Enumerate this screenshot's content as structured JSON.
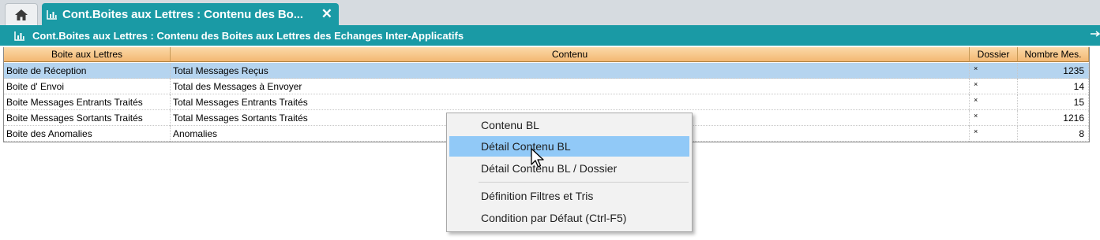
{
  "tabs": {
    "home_icon": "home-icon",
    "active_label": "Cont.Boites aux Lettres : Contenu des Bo...",
    "close_icon": "✕"
  },
  "titlebar": {
    "title": "Cont.Boites aux Lettres : Contenu des Boites aux Lettres des Echanges Inter-Applicatifs"
  },
  "table": {
    "columns": [
      "Boite aux Lettres",
      "Contenu",
      "Dossier",
      "Nombre Mes."
    ],
    "rows": [
      {
        "boite": "Boite de Réception",
        "contenu": "Total Messages Reçus",
        "dossier": "×",
        "nombre": "1235",
        "selected": true
      },
      {
        "boite": "Boite d' Envoi",
        "contenu": "Total des Messages à Envoyer",
        "dossier": "×",
        "nombre": "14"
      },
      {
        "boite": "Boite Messages Entrants Traités",
        "contenu": "Total Messages Entrants Traités",
        "dossier": "×",
        "nombre": "15"
      },
      {
        "boite": "Boite Messages Sortants Traités",
        "contenu": "Total Messages Sortants Traités",
        "dossier": "×",
        "nombre": "1216"
      },
      {
        "boite": "Boite des Anomalies",
        "contenu": "Anomalies",
        "dossier": "×",
        "nombre": "8"
      }
    ]
  },
  "context_menu": {
    "items": [
      "Contenu BL",
      "Détail Contenu BL",
      "Détail Contenu BL / Dossier",
      "Définition Filtres et Tris",
      "Condition par Défaut (Ctrl-F5)"
    ],
    "highlighted": "Détail Contenu BL"
  },
  "colors": {
    "accent": "#1a9aa5",
    "header": "#f3b872",
    "selection": "#b5d4ef",
    "menu_highlight": "#91c9f7"
  }
}
